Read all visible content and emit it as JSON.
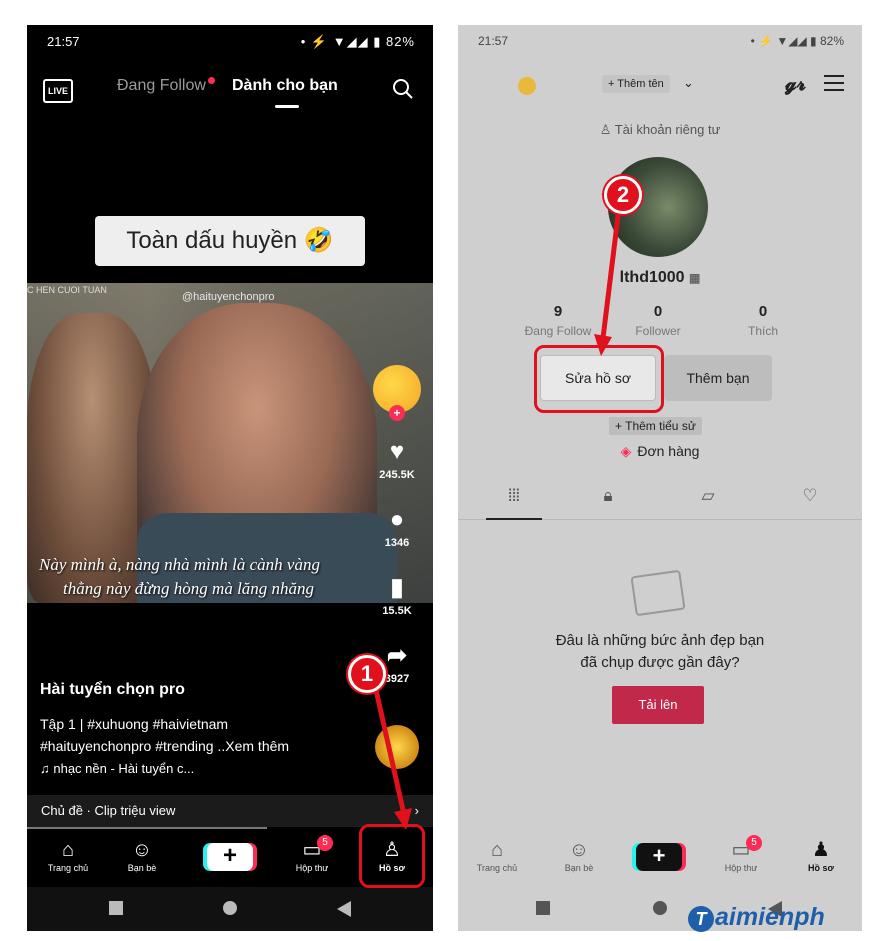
{
  "left": {
    "status": {
      "time": "21:57",
      "right": "• ⚡ ▼◢◢ ▮ 82%"
    },
    "tabs": {
      "following": "Đang Follow",
      "for_you": "Dành cho bạn"
    },
    "live_label": "LIVE",
    "caption": "Toàn dấu huyền 🤣",
    "watermark_top": "C HEN CUOI TUAN",
    "watermark_handle": "@haituyenchonpro",
    "subtitle_line1": "Này mình à, nàng nhà mình là cành vàng",
    "subtitle_line2": "thằng này đừng hòng mà lăng nhăng",
    "actions": {
      "likes": "245.5K",
      "comments": "1346",
      "saves": "15.5K",
      "shares": "3927"
    },
    "author": "Hài tuyển chọn pro",
    "desc_line1": "Tập 1 | #xuhuong #haivietnam",
    "desc_line2": "#haituyenchonpro #trending ..Xem thêm",
    "music": "♫ nhạc nền - Hài tuyển c...",
    "topic": "Chủ đề · Clip triệu view",
    "nav": {
      "home": "Trang chủ",
      "friends": "Bạn bè",
      "inbox": "Hộp thư",
      "inbox_badge": "5",
      "profile": "Hồ sơ"
    }
  },
  "right": {
    "status": {
      "time": "21:57",
      "right": "• ⚡ ▼◢◢ ▮ 82%"
    },
    "add_name": "+ Thêm tên",
    "private": "Tài khoản riêng tư",
    "username": "lthd1000",
    "stats": [
      {
        "num": "9",
        "label": "Đang Follow"
      },
      {
        "num": "0",
        "label": "Follower"
      },
      {
        "num": "0",
        "label": "Thích"
      }
    ],
    "edit_profile": "Sửa hồ sơ",
    "add_friends": "Thêm bạn",
    "add_bio": "+ Thêm tiểu sử",
    "orders": "Đơn hàng",
    "empty_line1": "Đâu là những bức ảnh đẹp bạn",
    "empty_line2": "đã chụp được gần đây?",
    "upload": "Tải lên",
    "nav": {
      "home": "Trang chủ",
      "friends": "Bạn bè",
      "inbox": "Hộp thư",
      "inbox_badge": "5",
      "profile": "Hồ sơ"
    }
  },
  "annotations": {
    "step1": "1",
    "step2": "2",
    "accent": "#e0101d"
  },
  "logo": {
    "mark": "T",
    "text": "aimienph"
  }
}
